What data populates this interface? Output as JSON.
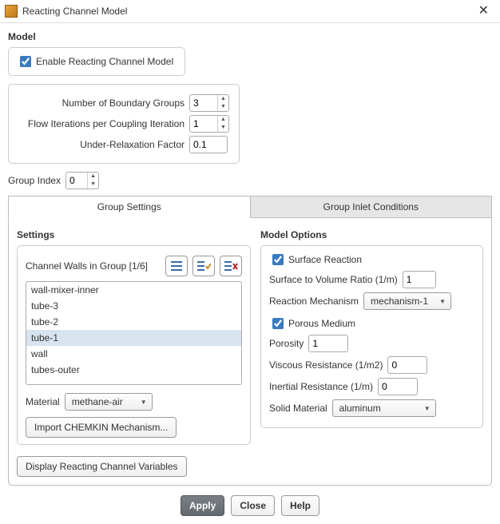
{
  "window": {
    "title": "Reacting Channel Model"
  },
  "model": {
    "heading": "Model",
    "enable_label": "Enable Reacting Channel Model",
    "enable_checked": true,
    "num_groups_label": "Number of Boundary Groups",
    "num_groups": "3",
    "flow_iter_label": "Flow Iterations per Coupling Iteration",
    "flow_iter": "1",
    "urf_label": "Under-Relaxation Factor",
    "urf": "0.1"
  },
  "group_index": {
    "label": "Group Index",
    "value": "0"
  },
  "tabs": {
    "settings_label": "Group Settings",
    "inlet_label": "Group Inlet Conditions",
    "active": "settings"
  },
  "settings": {
    "heading": "Settings",
    "walls_label": "Channel Walls in Group",
    "walls_count": "[1/6]",
    "walls": [
      "wall-mixer-inner",
      "tube-3",
      "tube-2",
      "tube-1",
      "wall",
      "tubes-outer"
    ],
    "walls_selected_index": 3,
    "material_label": "Material",
    "material_value": "methane-air",
    "import_btn": "Import CHEMKIN Mechanism..."
  },
  "model_options": {
    "heading": "Model Options",
    "surface_rxn_label": "Surface Reaction",
    "surface_rxn_checked": true,
    "svr_label": "Surface to Volume Ratio (1/m)",
    "svr_value": "1",
    "mech_label": "Reaction Mechanism",
    "mech_value": "mechanism-1",
    "porous_label": "Porous Medium",
    "porous_checked": true,
    "porosity_label": "Porosity",
    "porosity_value": "1",
    "visc_label": "Viscous Resistance (1/m2)",
    "visc_value": "0",
    "inert_label": "Inertial Resistance (1/m)",
    "inert_value": "0",
    "solid_label": "Solid Material",
    "solid_value": "aluminum"
  },
  "display_btn": "Display Reacting Channel Variables",
  "footer": {
    "apply": "Apply",
    "close": "Close",
    "help": "Help"
  }
}
